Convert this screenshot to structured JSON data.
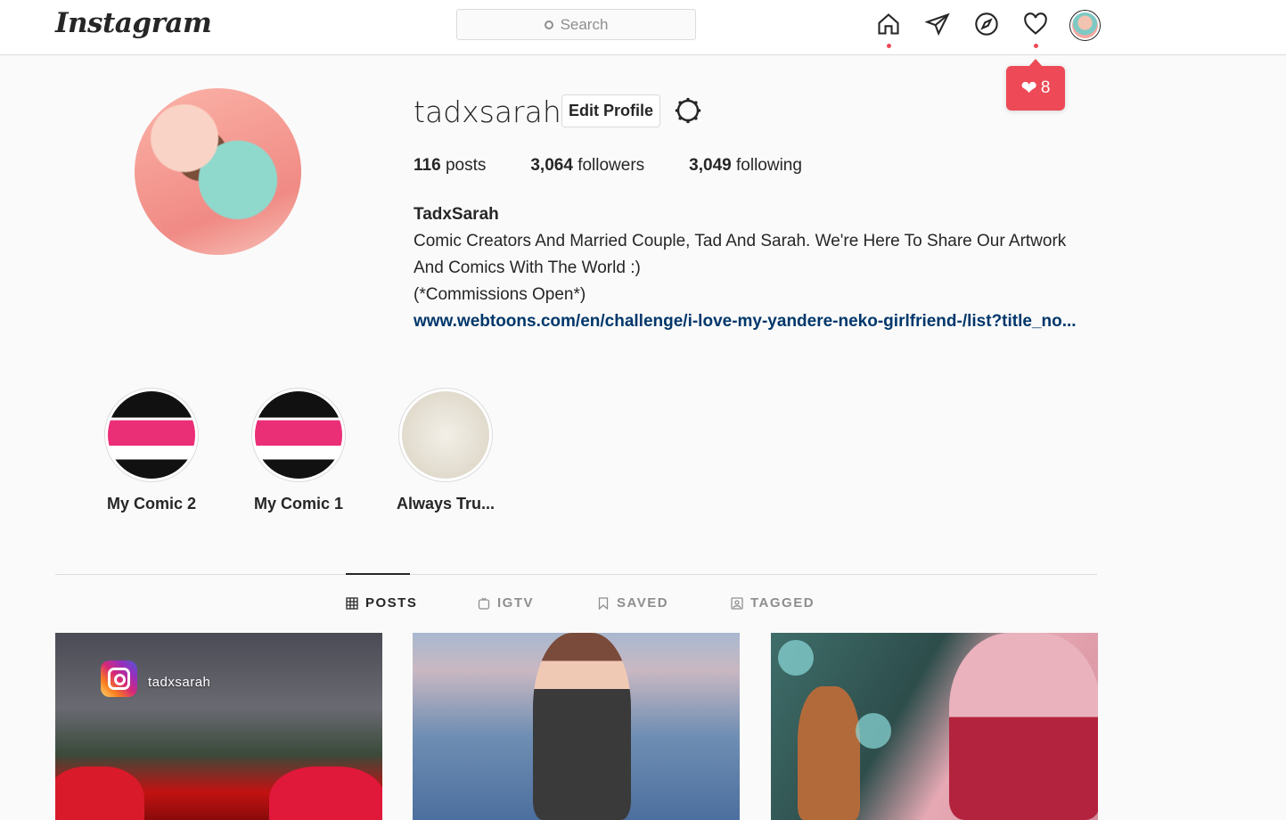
{
  "nav": {
    "logo": "Instagram",
    "search_placeholder": "Search",
    "icons": [
      "home-icon",
      "direct-icon",
      "explore-icon",
      "activity-icon",
      "profile-avatar"
    ]
  },
  "notification": {
    "count": "8",
    "icon": "heart-icon",
    "color": "#ed4956"
  },
  "profile": {
    "username": "tadxsarah",
    "edit_label": "Edit Profile",
    "stats": [
      {
        "count": "116",
        "label": "posts"
      },
      {
        "count": "3,064",
        "label": "followers"
      },
      {
        "count": "3,049",
        "label": "following"
      }
    ],
    "full_name": "TadxSarah",
    "bio_lines": [
      "Comic Creators And Married Couple, Tad And Sarah. We're Here To Share Our Artwork",
      "And Comics With The World :)",
      "(*Commissions Open*)"
    ],
    "link": "www.webtoons.com/en/challenge/i-love-my-yandere-neko-girlfriend-/list?title_no..."
  },
  "highlights": [
    {
      "label": "My Comic 2"
    },
    {
      "label": "My Comic 1"
    },
    {
      "label": "Always Tru..."
    }
  ],
  "tabs": [
    {
      "label": "POSTS",
      "active": true
    },
    {
      "label": "IGTV",
      "active": false
    },
    {
      "label": "SAVED",
      "active": false
    },
    {
      "label": "TAGGED",
      "active": false
    }
  ],
  "posts": [
    {
      "overlay_handle": "tadxsarah"
    },
    {},
    {}
  ],
  "colors": {
    "link": "#00376b",
    "accent_red": "#ed4956",
    "border": "#dbdbdb",
    "muted": "#8e8e8e"
  }
}
